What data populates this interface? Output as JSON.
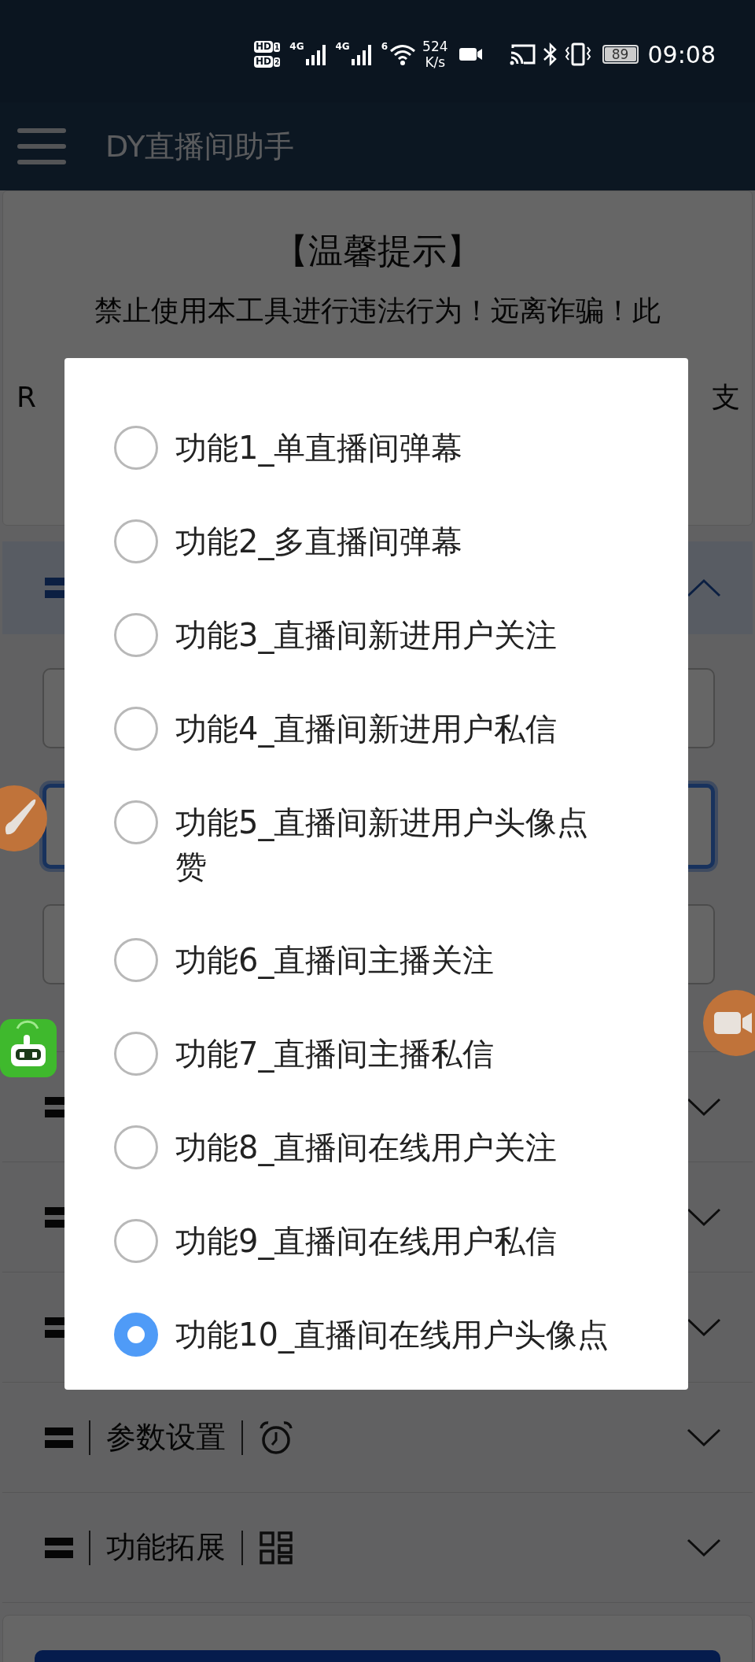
{
  "status_bar": {
    "sim_badges": [
      {
        "label": "HD",
        "slot": "1"
      },
      {
        "label": "HD",
        "slot": "2"
      }
    ],
    "networks": [
      "4G",
      "4G"
    ],
    "wifi_label": "6",
    "speed": "524",
    "speed_unit": "K/s",
    "battery": "89",
    "time": "09:08"
  },
  "app_bar": {
    "title": "DY直播间助手"
  },
  "notice": {
    "title": "【温馨提示】",
    "line": "禁止使用本工具进行违法行为！远离诈骗！此",
    "fragment_left": "R",
    "fragment_right": "支"
  },
  "sections": [
    {
      "expanded": true,
      "fields": [
        {
          "focused": false
        },
        {
          "focused": true
        },
        {
          "focused": false
        }
      ]
    },
    {
      "expanded": false
    },
    {
      "expanded": false
    },
    {
      "expanded": false
    },
    {
      "expanded": false,
      "title": "参数设置",
      "kind": "alarm"
    },
    {
      "expanded": false,
      "title": "功能拓展",
      "kind": "grid"
    }
  ],
  "dialog": {
    "options": [
      {
        "label": "功能1_单直播间弹幕",
        "selected": false
      },
      {
        "label": "功能2_多直播间弹幕",
        "selected": false
      },
      {
        "label": "功能3_直播间新进用户关注",
        "selected": false
      },
      {
        "label": "功能4_直播间新进用户私信",
        "selected": false
      },
      {
        "label": "功能5_直播间新进用户头像点赞",
        "selected": false
      },
      {
        "label": "功能6_直播间主播关注",
        "selected": false
      },
      {
        "label": "功能7_直播间主播私信",
        "selected": false
      },
      {
        "label": "功能8_直播间在线用户关注",
        "selected": false
      },
      {
        "label": "功能9_直播间在线用户私信",
        "selected": false
      },
      {
        "label": "功能10_直播间在线用户头像点",
        "selected": true
      }
    ]
  }
}
